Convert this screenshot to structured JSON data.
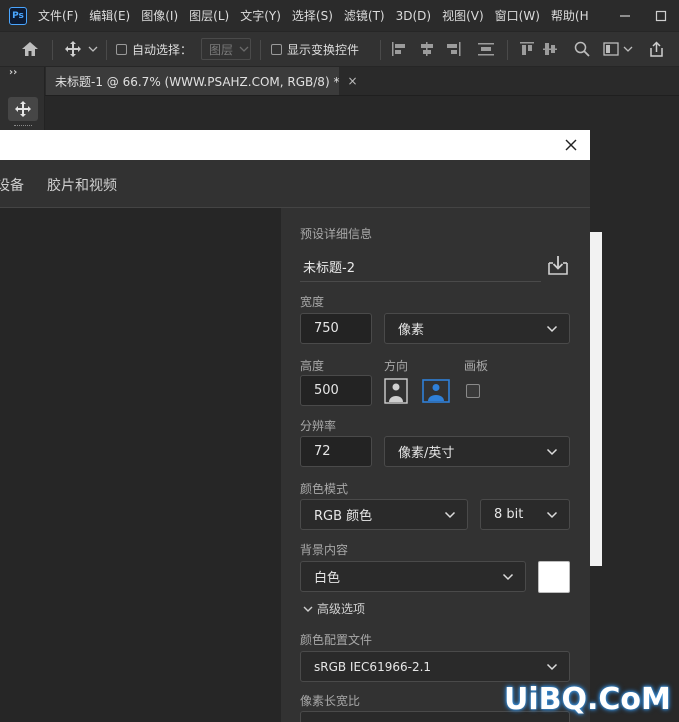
{
  "app": {
    "logo_text": "Ps",
    "menu": [
      "文件(F)",
      "编辑(E)",
      "图像(I)",
      "图层(L)",
      "文字(Y)",
      "选择(S)",
      "滤镜(T)",
      "3D(D)",
      "视图(V)",
      "窗口(W)",
      "帮助(H"
    ]
  },
  "options_bar": {
    "auto_select_label": "自动选择：",
    "layer_dropdown": "图层",
    "show_transform_label": "显示变换控件"
  },
  "tab": {
    "title": "未标题-1 @ 66.7% (WWW.PSAHZ.COM, RGB/8) *",
    "close": "×"
  },
  "toolstrip": {
    "collapse": "››"
  },
  "dialog": {
    "tabs": [
      "设备",
      "胶片和视频"
    ],
    "preset_details_label": "预设详细信息",
    "doc_name": "未标题-2",
    "width_label": "宽度",
    "width_value": "750",
    "width_unit": "像素",
    "height_label": "高度",
    "height_value": "500",
    "orientation_label": "方向",
    "artboard_label": "画板",
    "resolution_label": "分辨率",
    "resolution_value": "72",
    "resolution_unit": "像素/英寸",
    "color_mode_label": "颜色模式",
    "color_mode": "RGB 颜色",
    "bit_depth": "8 bit",
    "background_label": "背景内容",
    "background": "白色",
    "advanced_label": "高级选项",
    "color_profile_label": "颜色配置文件",
    "color_profile": "sRGB IEC61966-2.1",
    "pixel_aspect_label": "像素长宽比"
  },
  "watermark": "UiBQ.CoM",
  "colors": {
    "accent": "#2f80d8",
    "dialog_bg": "#323232",
    "canvas_bg": "#282828"
  }
}
